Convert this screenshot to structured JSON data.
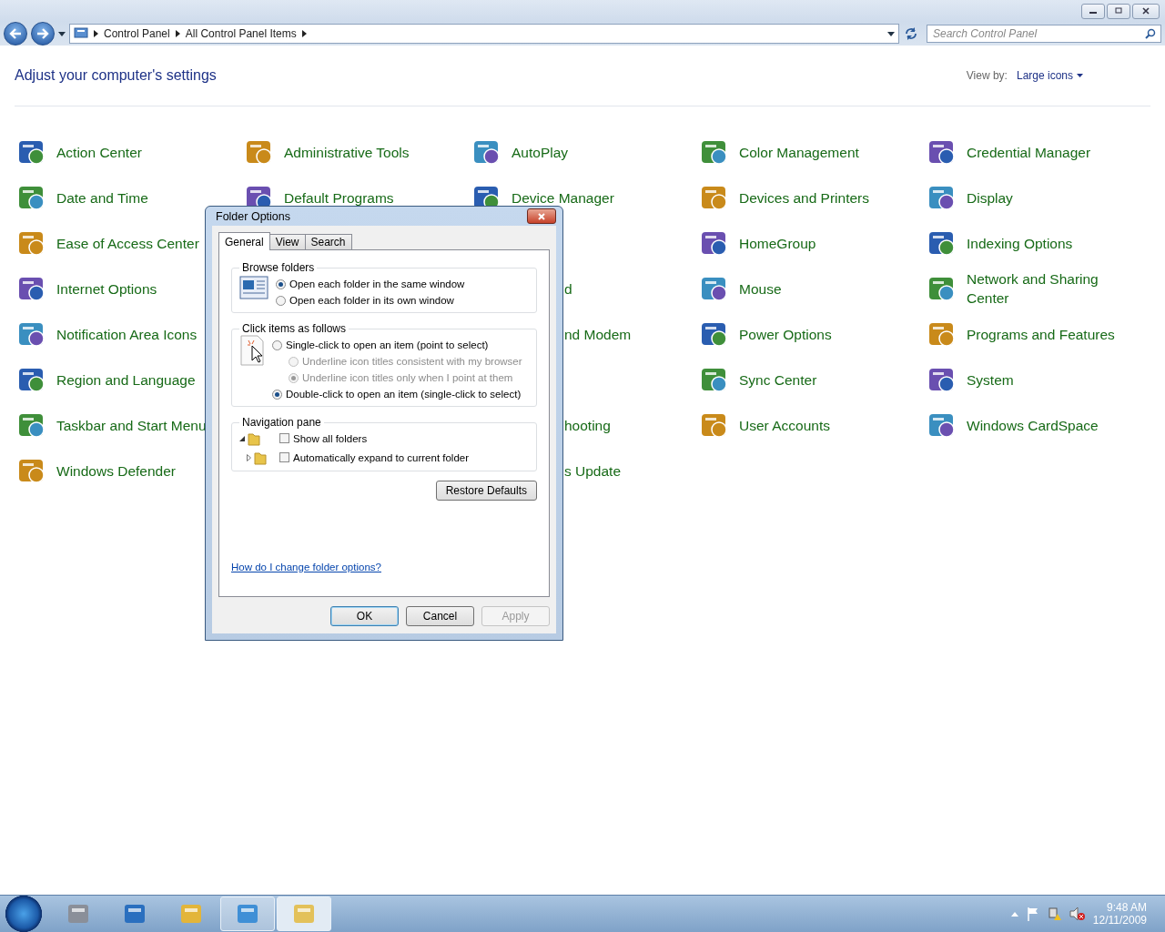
{
  "address_bar": {
    "crumbs": [
      "Control Panel",
      "All Control Panel Items"
    ]
  },
  "search": {
    "placeholder": "Search Control Panel"
  },
  "header": {
    "title": "Adjust your computer's settings",
    "view_by_label": "View by:",
    "view_by_value": "Large icons"
  },
  "items": [
    [
      {
        "label": "Action Center"
      },
      {
        "label": "Administrative Tools"
      },
      {
        "label": "AutoPlay"
      },
      {
        "label": "Color Management"
      },
      {
        "label": "Credential Manager"
      }
    ],
    [
      {
        "label": "Date and Time"
      },
      {
        "label": "Default Programs"
      },
      {
        "label": "Device Manager"
      },
      {
        "label": "Devices and Printers"
      },
      {
        "label": "Display"
      }
    ],
    [
      {
        "label": "Ease of Access Center"
      },
      {
        "kind": "covered"
      },
      {
        "kind": "covered"
      },
      {
        "label": "HomeGroup"
      },
      {
        "label": "Indexing Options"
      }
    ],
    [
      {
        "label": "Internet Options"
      },
      {
        "kind": "covered"
      },
      {
        "label": "d",
        "kind": "partial"
      },
      {
        "label": "Mouse"
      },
      {
        "label": "Network and Sharing Center"
      }
    ],
    [
      {
        "label": "Notification Area Icons"
      },
      {
        "kind": "covered"
      },
      {
        "label": "nd Modem",
        "kind": "partial"
      },
      {
        "label": "Power Options"
      },
      {
        "label": "Programs and Features"
      }
    ],
    [
      {
        "label": "Region and Language"
      },
      {
        "kind": "covered"
      },
      {
        "kind": "covered"
      },
      {
        "label": "Sync Center"
      },
      {
        "label": "System"
      }
    ],
    [
      {
        "label": "Taskbar and Start Menu"
      },
      {
        "kind": "covered"
      },
      {
        "label": "hooting",
        "kind": "partial"
      },
      {
        "label": "User Accounts"
      },
      {
        "label": "Windows CardSpace"
      }
    ],
    [
      {
        "label": "Windows Defender"
      },
      {
        "kind": "covered"
      },
      {
        "label": "s Update",
        "kind": "partial"
      }
    ]
  ],
  "dialog": {
    "title": "Folder Options",
    "tabs": [
      {
        "label": "General",
        "selected": true
      },
      {
        "label": "View",
        "selected": false
      },
      {
        "label": "Search",
        "selected": false
      }
    ],
    "groups": [
      {
        "title": "Browse folders",
        "options": [
          {
            "kind": "radio",
            "label": "Open each folder in the same window",
            "selected": true,
            "disabled": false
          },
          {
            "kind": "radio",
            "label": "Open each folder in its own window",
            "selected": false,
            "disabled": false
          }
        ]
      },
      {
        "title": "Click items as follows",
        "options": [
          {
            "kind": "radio",
            "label": "Single-click to open an item (point to select)",
            "selected": false,
            "disabled": false,
            "children": [
              {
                "label": "Underline icon titles consistent with my browser",
                "selected": false,
                "disabled": true
              },
              {
                "label": "Underline icon titles only when I point at them",
                "selected": true,
                "disabled": true
              }
            ]
          },
          {
            "kind": "radio",
            "label": "Double-click to open an item (single-click to select)",
            "selected": true,
            "disabled": false
          }
        ]
      },
      {
        "title": "Navigation pane",
        "options": [
          {
            "kind": "checkbox",
            "label": "Show all folders",
            "checked": false
          },
          {
            "kind": "checkbox",
            "label": "Automatically expand to current folder",
            "checked": false
          }
        ]
      }
    ],
    "restore_button": "Restore Defaults",
    "help_link": "How do I change folder options?",
    "buttons": [
      {
        "label": "OK",
        "default": true,
        "disabled": false
      },
      {
        "label": "Cancel",
        "default": false,
        "disabled": false
      },
      {
        "label": "Apply",
        "default": false,
        "disabled": true
      }
    ]
  },
  "taskbar": {
    "buttons": [
      {
        "running": false,
        "selected": false
      },
      {
        "running": false,
        "selected": false
      },
      {
        "running": false,
        "selected": false
      },
      {
        "running": true,
        "selected": false
      },
      {
        "running": true,
        "selected": true
      }
    ],
    "clock_time": "9:48 AM",
    "clock_date": "12/11/2009"
  }
}
